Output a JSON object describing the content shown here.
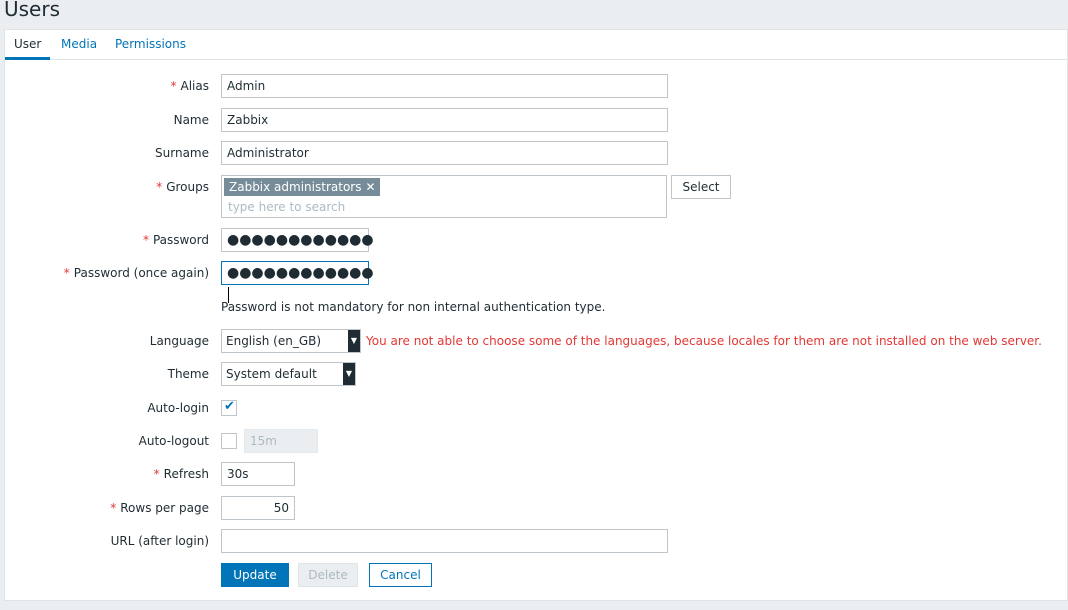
{
  "page": {
    "title": "Users"
  },
  "tabs": [
    {
      "label": "User",
      "active": true
    },
    {
      "label": "Media",
      "active": false
    },
    {
      "label": "Permissions",
      "active": false
    }
  ],
  "form": {
    "alias": {
      "label": "Alias",
      "value": "Admin",
      "required": true
    },
    "name": {
      "label": "Name",
      "value": "Zabbix"
    },
    "surname": {
      "label": "Surname",
      "value": "Administrator"
    },
    "groups": {
      "label": "Groups",
      "required": true,
      "selected": [
        "Zabbix administrators"
      ],
      "placeholder": "type here to search",
      "select_button": "Select"
    },
    "password": {
      "label": "Password",
      "value": "●●●●●●●●●●●●",
      "required": true
    },
    "password_again": {
      "label": "Password (once again)",
      "value": "●●●●●●●●●●●●",
      "required": true
    },
    "password_hint": "Password is not mandatory for non internal authentication type.",
    "language": {
      "label": "Language",
      "value": "English (en_GB)",
      "warning": "You are not able to choose some of the languages, because locales for them are not installed on the web server."
    },
    "theme": {
      "label": "Theme",
      "value": "System default"
    },
    "autologin": {
      "label": "Auto-login",
      "checked": true
    },
    "autologout": {
      "label": "Auto-logout",
      "checked": false,
      "value": "15m"
    },
    "refresh": {
      "label": "Refresh",
      "value": "30s",
      "required": true
    },
    "rows_per_page": {
      "label": "Rows per page",
      "value": "50",
      "required": true
    },
    "url": {
      "label": "URL (after login)",
      "value": ""
    }
  },
  "buttons": {
    "update": "Update",
    "delete": "Delete",
    "cancel": "Cancel"
  },
  "colors": {
    "accent": "#0275b8",
    "required": "#e33734",
    "chip": "#768d99"
  },
  "icons": {
    "remove_chip": "close-icon",
    "checkbox_checked": "checkmark-icon",
    "dropdown": "caret-down-icon"
  }
}
